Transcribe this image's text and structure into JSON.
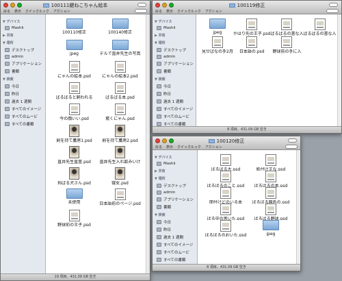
{
  "colors": {
    "close": "#e0443e",
    "minimize": "#dea123",
    "zoom": "#1aab29",
    "folder": "#7ba7d6",
    "sidebar": "#e4e9ef"
  },
  "windows": [
    {
      "title": "100111鍵ねこちゃん絵本",
      "toolbar": [
        "戻る",
        "表示",
        "クイックルック",
        "アクション"
      ],
      "sidebar": [
        {
          "heading": "▼ デバイス",
          "items": [
            {
              "icon": "hard-disk-icon",
              "label": "Mashii"
            }
          ]
        },
        {
          "heading": "▶ 共有",
          "items": []
        },
        {
          "heading": "▼ 場所",
          "items": [
            {
              "icon": "desktop-icon",
              "label": "デスクトップ"
            },
            {
              "icon": "home-icon",
              "label": "admin"
            },
            {
              "icon": "applications-icon",
              "label": "アプリケーション"
            },
            {
              "icon": "documents-icon",
              "label": "書類"
            }
          ]
        },
        {
          "heading": "▼ 検索",
          "items": [
            {
              "icon": "clock-icon",
              "label": "今日"
            },
            {
              "icon": "clock-icon",
              "label": "昨日"
            },
            {
              "icon": "clock-icon",
              "label": "過去 1 週間"
            },
            {
              "icon": "smart-folder-icon",
              "label": "すべてのイメージ"
            },
            {
              "icon": "smart-folder-icon",
              "label": "すべてのムービ"
            },
            {
              "icon": "smart-folder-icon",
              "label": "すべての書類"
            }
          ]
        }
      ],
      "files": [
        {
          "type": "folder",
          "name": "100110修正"
        },
        {
          "type": "folder",
          "name": "100140修正"
        },
        {
          "type": "folder",
          "name": "jpeg"
        },
        {
          "type": "folder",
          "name": "デルで直井先生の写真"
        },
        {
          "type": "doc",
          "name": "にゃんの絵本.psd"
        },
        {
          "type": "doc",
          "name": "にゃんの絵本2.psd"
        },
        {
          "type": "doc",
          "name": "ばるばると飼われる"
        },
        {
          "type": "doc",
          "name": "ばるばる本.psd"
        },
        {
          "type": "doc",
          "name": "今の顔いい.psd"
        },
        {
          "type": "doc",
          "name": "驚くにゃん.psd"
        },
        {
          "type": "art",
          "name": "剣を持て鷹男1.psd"
        },
        {
          "type": "art",
          "name": "剣を持て鷹男2.psd"
        },
        {
          "type": "art",
          "name": "直井先生直置.psd"
        },
        {
          "type": "art",
          "name": "直井先生入れ飲みいけ"
        },
        {
          "type": "art",
          "name": "拘ばる犬さん.psd"
        },
        {
          "type": "art",
          "name": "寝女.psd"
        },
        {
          "type": "folder",
          "name": "未使用"
        },
        {
          "type": "doc",
          "name": "日本語前のページ.psd"
        },
        {
          "type": "doc",
          "name": "野球前の王子.psd"
        }
      ],
      "status": "19 項目、431.09 GB 空き"
    },
    {
      "title": "100119修正",
      "toolbar": [
        "戻る",
        "表示",
        "クイックルック",
        "アクション"
      ],
      "sidebar": [
        {
          "heading": "▼ デバイス",
          "items": [
            {
              "icon": "hard-disk-icon",
              "label": "Mashii"
            }
          ]
        },
        {
          "heading": "▶ 共有",
          "items": []
        },
        {
          "heading": "▼ 場所",
          "items": [
            {
              "icon": "desktop-icon",
              "label": "デスクトップ"
            },
            {
              "icon": "home-icon",
              "label": "admin"
            },
            {
              "icon": "applications-icon",
              "label": "アプリケーション"
            },
            {
              "icon": "documents-icon",
              "label": "書類"
            }
          ]
        },
        {
          "heading": "▼ 検索",
          "items": [
            {
              "icon": "clock-icon",
              "label": "今日"
            },
            {
              "icon": "clock-icon",
              "label": "昨日"
            },
            {
              "icon": "clock-icon",
              "label": "過去 1 週間"
            },
            {
              "icon": "smart-folder-icon",
              "label": "すべてのイメージ"
            },
            {
              "icon": "smart-folder-icon",
              "label": "すべてのムービ"
            },
            {
              "icon": "smart-folder-icon",
              "label": "すべての書類"
            }
          ]
        }
      ],
      "files": [
        {
          "type": "folder",
          "name": "jpeg"
        },
        {
          "type": "doc",
          "name": "やはり先の王子.psd"
        },
        {
          "type": "doc",
          "name": "ばるばるの書な入"
        },
        {
          "type": "doc",
          "name": "ばるばるの書な入"
        },
        {
          "type": "doc",
          "name": "見せばなの手2月"
        },
        {
          "type": "doc",
          "name": "日本語の.psd"
        },
        {
          "type": "doc",
          "name": "野球前の手に入"
        }
      ],
      "status": "8 項目、431.09 GB 空き"
    },
    {
      "title": "100120修正",
      "toolbar": [
        "戻る",
        "表示",
        "クイックルック",
        "アクション"
      ],
      "sidebar": [
        {
          "heading": "▼ デバイス",
          "items": [
            {
              "icon": "hard-disk-icon",
              "label": "Mashii"
            }
          ]
        },
        {
          "heading": "▶ 共有",
          "items": []
        },
        {
          "heading": "▼ 場所",
          "items": [
            {
              "icon": "desktop-icon",
              "label": "デスクトップ"
            },
            {
              "icon": "home-icon",
              "label": "admin"
            },
            {
              "icon": "applications-icon",
              "label": "アプリケーション"
            },
            {
              "icon": "documents-icon",
              "label": "書類"
            }
          ]
        },
        {
          "heading": "▼ 検索",
          "items": [
            {
              "icon": "clock-icon",
              "label": "今日"
            },
            {
              "icon": "clock-icon",
              "label": "昨日"
            },
            {
              "icon": "clock-icon",
              "label": "過去 1 週間"
            },
            {
              "icon": "smart-folder-icon",
              "label": "すべてのイメージ"
            },
            {
              "icon": "smart-folder-icon",
              "label": "すべてのムービ"
            },
            {
              "icon": "smart-folder-icon",
              "label": "すべての書類"
            }
          ]
        }
      ],
      "files": [
        {
          "type": "doc",
          "name": "ばるばる大.psd"
        },
        {
          "type": "doc",
          "name": "紙付けすな.psd"
        },
        {
          "type": "doc",
          "name": "ばるばるのこと.psd"
        },
        {
          "type": "doc",
          "name": "ばるばるの本.psd"
        },
        {
          "type": "doc",
          "name": "間付けどのいる本"
        },
        {
          "type": "doc",
          "name": "ばるばる無色の.psd"
        },
        {
          "type": "doc",
          "name": "ばる中の黒いた.psd"
        },
        {
          "type": "doc",
          "name": "ばるばる野球.psd"
        },
        {
          "type": "doc",
          "name": "ばるばるのおいた.psd"
        },
        {
          "type": "folder",
          "name": "jpeg"
        }
      ],
      "status": "8 項目、431.09 GB 空き"
    }
  ]
}
